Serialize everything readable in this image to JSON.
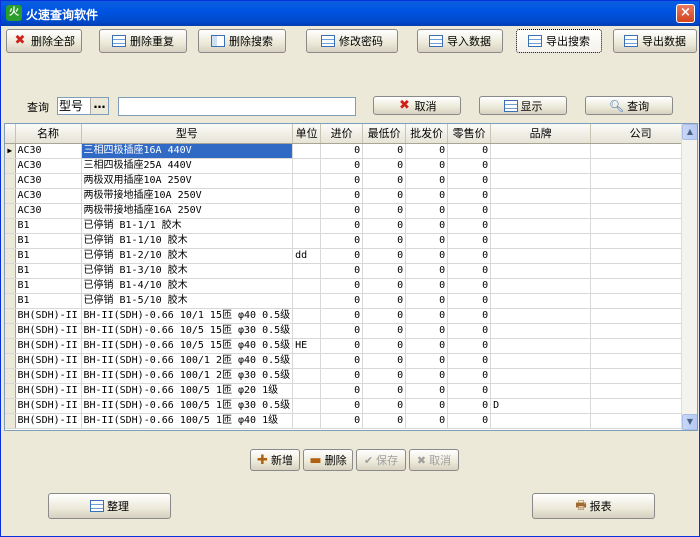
{
  "window": {
    "title": "火速查询软件",
    "icon_char": "火",
    "close_glyph": "×"
  },
  "toolbar": [
    {
      "label": "删除全部",
      "icon": "delete-icon"
    },
    {
      "label": "删除重复",
      "icon": "grid-icon"
    },
    {
      "label": "删除搜索",
      "icon": "grid-search-icon"
    },
    {
      "label": "修改密码",
      "icon": "grid-icon"
    },
    {
      "label": "导入数据",
      "icon": "grid-icon"
    },
    {
      "label": "导出搜索",
      "icon": "grid-icon"
    },
    {
      "label": "导出数据",
      "icon": "grid-icon"
    }
  ],
  "query": {
    "label": "查询",
    "field_value": "型号",
    "field_button": "…",
    "input_value": "",
    "cancel_label": "取消",
    "show_label": "显示",
    "search_label": "查询"
  },
  "table": {
    "columns": [
      "名称",
      "型号",
      "单位",
      "进价",
      "最低价",
      "批发价",
      "零售价",
      "品牌",
      "公司"
    ],
    "rows": [
      [
        "AC30",
        "三相四极插座16A 440V",
        "",
        "0",
        "0",
        "0",
        "0",
        "",
        ""
      ],
      [
        "AC30",
        "三相四极插座25A 440V",
        "",
        "0",
        "0",
        "0",
        "0",
        "",
        ""
      ],
      [
        "AC30",
        "两极双用插座10A 250V",
        "",
        "0",
        "0",
        "0",
        "0",
        "",
        ""
      ],
      [
        "AC30",
        "两极带接地插座10A 250V",
        "",
        "0",
        "0",
        "0",
        "0",
        "",
        ""
      ],
      [
        "AC30",
        "两极带接地插座16A 250V",
        "",
        "0",
        "0",
        "0",
        "0",
        "",
        ""
      ],
      [
        "B1",
        "已停销 B1-1/1 胶木",
        "",
        "0",
        "0",
        "0",
        "0",
        "",
        ""
      ],
      [
        "B1",
        "已停销 B1-1/10 胶木",
        "",
        "0",
        "0",
        "0",
        "0",
        "",
        ""
      ],
      [
        "B1",
        "已停销 B1-2/10 胶木",
        "dd",
        "0",
        "0",
        "0",
        "0",
        "",
        ""
      ],
      [
        "B1",
        "已停销 B1-3/10 胶木",
        "",
        "0",
        "0",
        "0",
        "0",
        "",
        ""
      ],
      [
        "B1",
        "已停销 B1-4/10 胶木",
        "",
        "0",
        "0",
        "0",
        "0",
        "",
        ""
      ],
      [
        "B1",
        "已停销 B1-5/10 胶木",
        "",
        "0",
        "0",
        "0",
        "0",
        "",
        ""
      ],
      [
        "BH(SDH)-II",
        "BH-II(SDH)-0.66 10/1 15匝 φ40 0.5级",
        "",
        "0",
        "0",
        "0",
        "0",
        "",
        ""
      ],
      [
        "BH(SDH)-II",
        "BH-II(SDH)-0.66 10/5 15匝 φ30 0.5级",
        "",
        "0",
        "0",
        "0",
        "0",
        "",
        ""
      ],
      [
        "BH(SDH)-II",
        "BH-II(SDH)-0.66 10/5 15匝 φ40 0.5级",
        "HE",
        "0",
        "0",
        "0",
        "0",
        "",
        ""
      ],
      [
        "BH(SDH)-II",
        "BH-II(SDH)-0.66 100/1 2匝 φ40 0.5级",
        "",
        "0",
        "0",
        "0",
        "0",
        "",
        ""
      ],
      [
        "BH(SDH)-II",
        "BH-II(SDH)-0.66 100/1 2匝 φ30 0.5级",
        "",
        "0",
        "0",
        "0",
        "0",
        "",
        ""
      ],
      [
        "BH(SDH)-II",
        "BH-II(SDH)-0.66 100/5 1匝 φ20 1级",
        "",
        "0",
        "0",
        "0",
        "0",
        "",
        ""
      ],
      [
        "BH(SDH)-II",
        "BH-II(SDH)-0.66 100/5 1匝 φ30 0.5级",
        "",
        "0",
        "0",
        "0",
        "0",
        "D",
        ""
      ],
      [
        "BH(SDH)-II",
        "BH-II(SDH)-0.66 100/5 1匝 φ40 1级",
        "",
        "0",
        "0",
        "0",
        "0",
        "",
        ""
      ]
    ]
  },
  "record_actions": {
    "add_label": "新增",
    "delete_label": "删除",
    "save_label": "保存",
    "cancel_label": "取消"
  },
  "footer": {
    "organize_label": "整理",
    "report_label": "报表"
  },
  "colors": {
    "selected_row": "#316ac5",
    "titlebar": "#0054e3",
    "delete_red": "#d0201a"
  }
}
